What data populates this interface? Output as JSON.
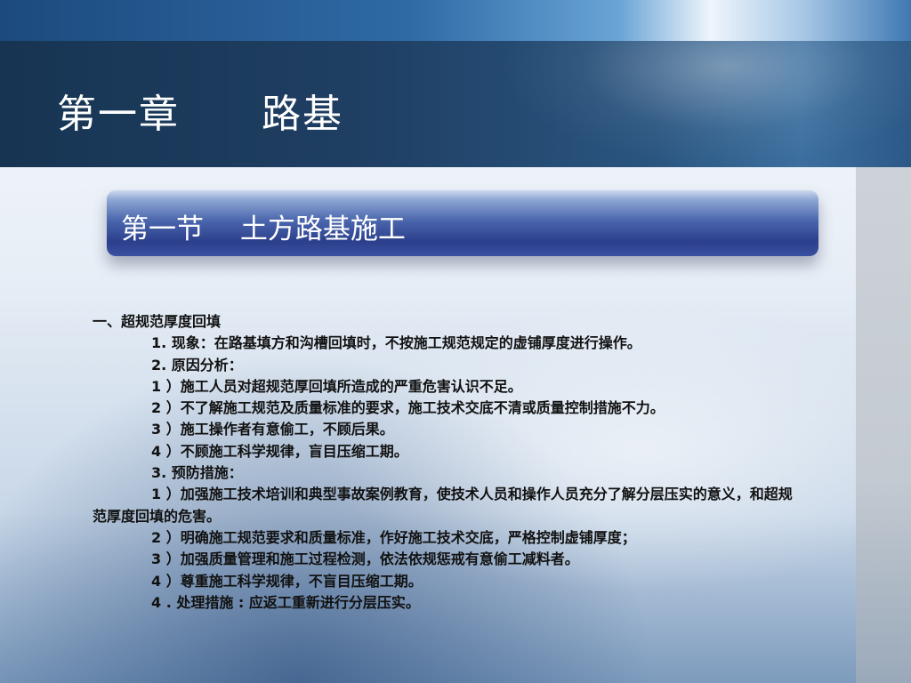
{
  "slide": {
    "chapter_title": "第一章　　路基",
    "section_title": "第一节　 土方路基施工",
    "heading": "一、超规范厚度回填",
    "items": [
      "1. 现象：在路基填方和沟槽回填时，不按施工规范规定的虚铺厚度进行操作。",
      "2. 原因分析：",
      "1 ）施工人员对超规范厚回填所造成的严重危害认识不足。",
      "2 ）不了解施工规范及质量标准的要求，施工技术交底不清或质量控制措施不力。",
      "3 ）施工操作者有意偷工，不顾后果。",
      "4 ）不顾施工科学规律，盲目压缩工期。",
      "3. 预防措施：",
      "1 ）加强施工技术培训和典型事故案例教育，使技术人员和操作人员充分了解分层压实的意义，和超规范厚度回填的危害。",
      "2 ）明确施工规范要求和质量标准，作好施工技术交底，严格控制虚铺厚度；",
      "3 ）加强质量管理和施工过程检测，依法依规惩戒有意偷工减料者。",
      "4 ）尊重施工科学规律，不盲目压缩工期。",
      "4 .  处理措施 : 应返工重新进行分层压实。"
    ]
  }
}
